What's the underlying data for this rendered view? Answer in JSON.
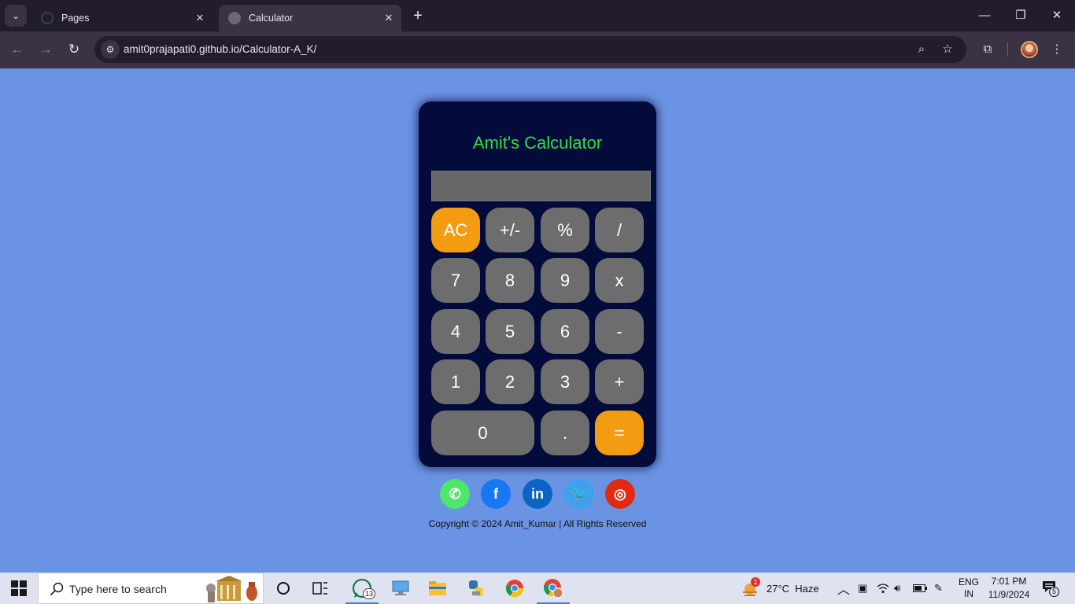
{
  "browser": {
    "tabs": [
      {
        "title": "Pages"
      },
      {
        "title": "Calculator"
      }
    ],
    "url": "amit0prajapati0.github.io/Calculator-A_K/"
  },
  "calculator": {
    "title": "Amit's Calculator",
    "display_value": "",
    "keys": {
      "ac": "AC",
      "sign": "+/-",
      "percent": "%",
      "divide": "/",
      "seven": "7",
      "eight": "8",
      "nine": "9",
      "multiply": "x",
      "four": "4",
      "five": "5",
      "six": "6",
      "minus": "-",
      "one": "1",
      "two": "2",
      "three": "3",
      "plus": "+",
      "zero": "0",
      "decimal": ".",
      "equals": "="
    },
    "colors": {
      "accent": "#f39c12",
      "key": "#6d6d6d",
      "body": "#020b3a",
      "title": "#28e04a"
    }
  },
  "socials": [
    {
      "name": "whatsapp",
      "glyph": "✆",
      "color": "#4ee66b"
    },
    {
      "name": "facebook",
      "glyph": "f",
      "color": "#1877f2"
    },
    {
      "name": "linkedin",
      "glyph": "in",
      "color": "#0a66c2"
    },
    {
      "name": "twitter",
      "glyph": "🐦",
      "color": "#3fa1ec"
    },
    {
      "name": "instagram",
      "glyph": "◎",
      "color": "#e12a10"
    }
  ],
  "footer": {
    "text": "Copyright © 2024 Amit_Kumar | All Rights Reserved"
  },
  "taskbar": {
    "search_placeholder": "Type here to search",
    "whatsapp_badge": "13",
    "weather_alert": "1",
    "weather": "27°C  Haze",
    "lang_top": "ENG",
    "lang_bottom": "IN",
    "time": "7:01 PM",
    "date": "11/9/2024",
    "notifications": "5"
  }
}
